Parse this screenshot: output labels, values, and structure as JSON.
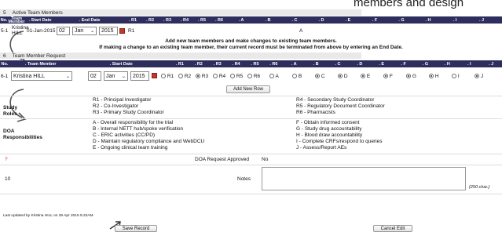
{
  "caption": "members and design",
  "section5": {
    "number": "5",
    "title": "Active Team Members",
    "headers": [
      "No.",
      "Team Member",
      ". Start Date",
      ". End Date",
      ". R1",
      ". R2",
      ". R3",
      ". R4",
      ". R5",
      ". R6",
      ". A",
      ". B",
      ". C",
      ". D",
      ". E",
      ". F",
      ". G",
      ". H",
      ". I",
      ". J"
    ],
    "row": {
      "no": "5-1",
      "member_line1": "Kristina",
      "member_line2": "HILL",
      "start_date": "01-Jan-2015",
      "end_day": "02",
      "end_month": "Jan",
      "end_year": "2015",
      "r_value": "R1",
      "a_value": "A"
    },
    "note1": "Add new team members and make changes to existing team members.",
    "note2": "If making a change to an existing team member, their current record must be terminated from above by entering an End Date."
  },
  "section6": {
    "number": "6",
    "title": "Team Member Request",
    "headers": [
      "No.",
      ". Team Member",
      ". Start Date",
      ". R1",
      ". R2",
      ". R3",
      ". R4",
      ". R5",
      ". R6",
      ". A",
      ". B",
      ". C",
      ". D",
      ". E",
      ". F",
      ". G",
      ". H",
      ". I",
      ". J"
    ],
    "row": {
      "no": "6-1",
      "member": "Kristina HILL",
      "start_day": "02",
      "start_month": "Jan",
      "start_year": "2015",
      "roles": [
        {
          "label": "R1",
          "selected": false
        },
        {
          "label": "R2",
          "selected": false
        },
        {
          "label": "R3",
          "selected": true
        },
        {
          "label": "R4",
          "selected": false
        },
        {
          "label": "R5",
          "selected": false
        },
        {
          "label": "R6",
          "selected": false
        }
      ],
      "resp": [
        {
          "label": "A",
          "selected": false
        },
        {
          "label": "B",
          "selected": false
        },
        {
          "label": "C",
          "selected": true
        },
        {
          "label": "D",
          "selected": true
        },
        {
          "label": "E",
          "selected": true
        },
        {
          "label": "F",
          "selected": true
        },
        {
          "label": "G",
          "selected": true
        },
        {
          "label": "H",
          "selected": true
        },
        {
          "label": "I",
          "selected": false
        },
        {
          "label": "J",
          "selected": true
        }
      ]
    },
    "add_row": "Add New Row"
  },
  "study_roles": {
    "label1": "Study",
    "label2": "Roles",
    "left": [
      "R1 - Principal Investigator",
      "R2 - Co-Investigator",
      "R3 - Primary Study Coordinator"
    ],
    "right": [
      "R4 - Secondary Study Coordinator",
      "R5 - Regulatory Document Coordinator",
      "R6 - Pharmacists"
    ]
  },
  "doa": {
    "label1": "DOA",
    "label2": "Responsibilities",
    "left": [
      "A - Overall responsibility for the trial",
      "B - Internal NETT hub/spoke verification",
      "C - ERIC activities (CC/PD)",
      "D - Maintain regulatory compliance and WebDCU",
      "E - Ongoing clinical team training"
    ],
    "right": [
      "F - Obtain informed consent",
      "G - Study drug accountability",
      "H - Blood draw accountability",
      "I - Complete CRFs/respond to queries",
      "J - Assess/Report AEs"
    ]
  },
  "approved": {
    "marker": "?",
    "label": "DOA Request Approved",
    "value": "No"
  },
  "notes": {
    "number": "10",
    "label": "Notes",
    "value": "",
    "limit": "(250 char.)"
  },
  "footer": {
    "last_updated": "Last updated by Kristina HILL on 28 Apr 2015 5:22AM",
    "save": "Save Record",
    "cancel": "Cancel Edit"
  }
}
